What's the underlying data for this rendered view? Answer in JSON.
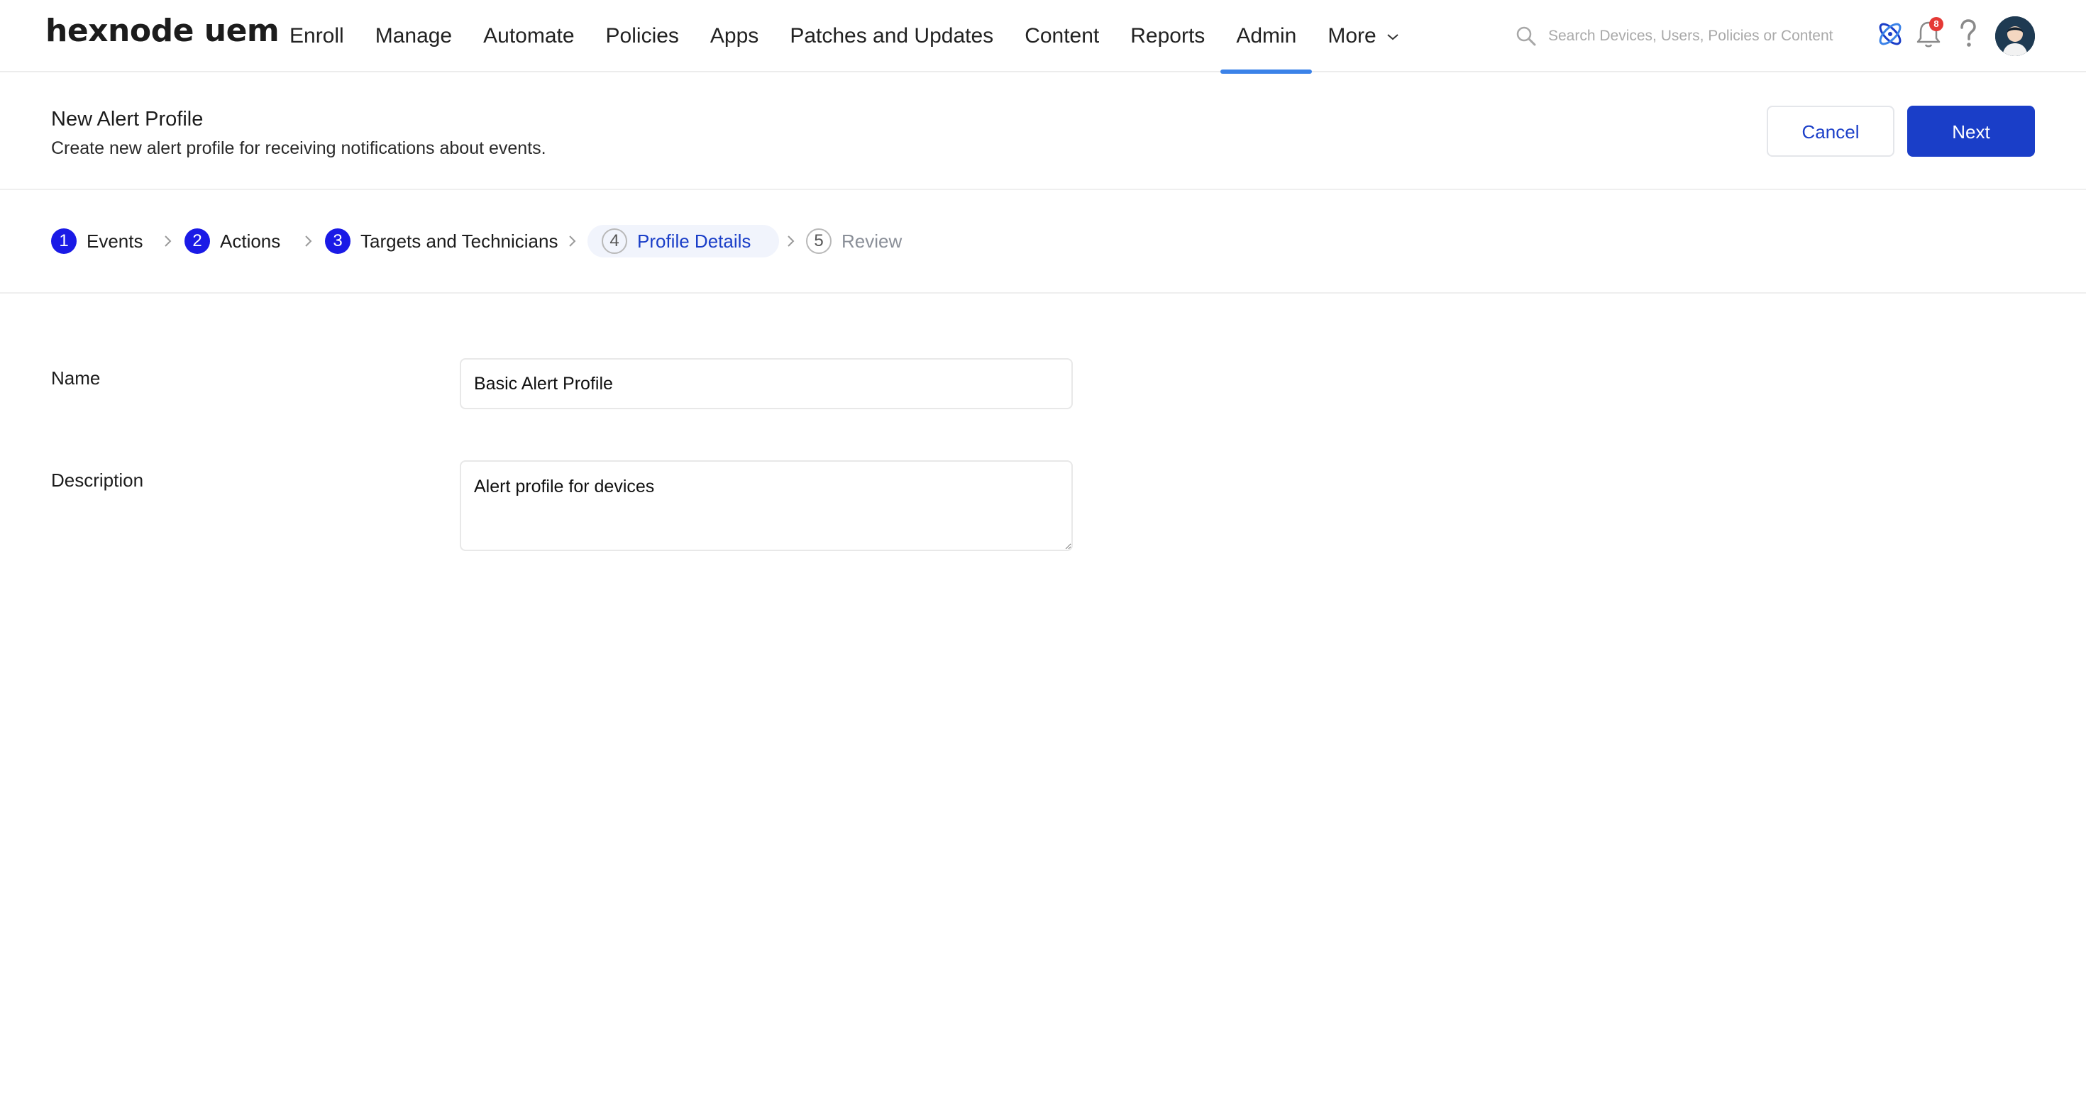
{
  "nav": {
    "logo": "hexnode uem",
    "items": [
      {
        "label": "Enroll"
      },
      {
        "label": "Manage"
      },
      {
        "label": "Automate"
      },
      {
        "label": "Policies"
      },
      {
        "label": "Apps"
      },
      {
        "label": "Patches and Updates"
      },
      {
        "label": "Content"
      },
      {
        "label": "Reports"
      },
      {
        "label": "Admin",
        "active": true
      },
      {
        "label": "More"
      }
    ],
    "search_placeholder": "Search Devices, Users, Policies or Content",
    "notification_count": "8",
    "accent_color": "#3b82e8"
  },
  "header": {
    "title": "New Alert Profile",
    "subtitle": "Create new alert profile for receiving notifications about events.",
    "cancel_label": "Cancel",
    "next_label": "Next",
    "primary_color": "#1a3ec8"
  },
  "steps": [
    {
      "number": "1",
      "label": "Events",
      "state": "done"
    },
    {
      "number": "2",
      "label": "Actions",
      "state": "done"
    },
    {
      "number": "3",
      "label": "Targets and Technicians",
      "state": "done"
    },
    {
      "number": "4",
      "label": "Profile Details",
      "state": "current"
    },
    {
      "number": "5",
      "label": "Review",
      "state": "todo"
    }
  ],
  "form": {
    "name_label": "Name",
    "name_value": "Basic Alert Profile",
    "description_label": "Description",
    "description_value": "Alert profile for devices"
  }
}
